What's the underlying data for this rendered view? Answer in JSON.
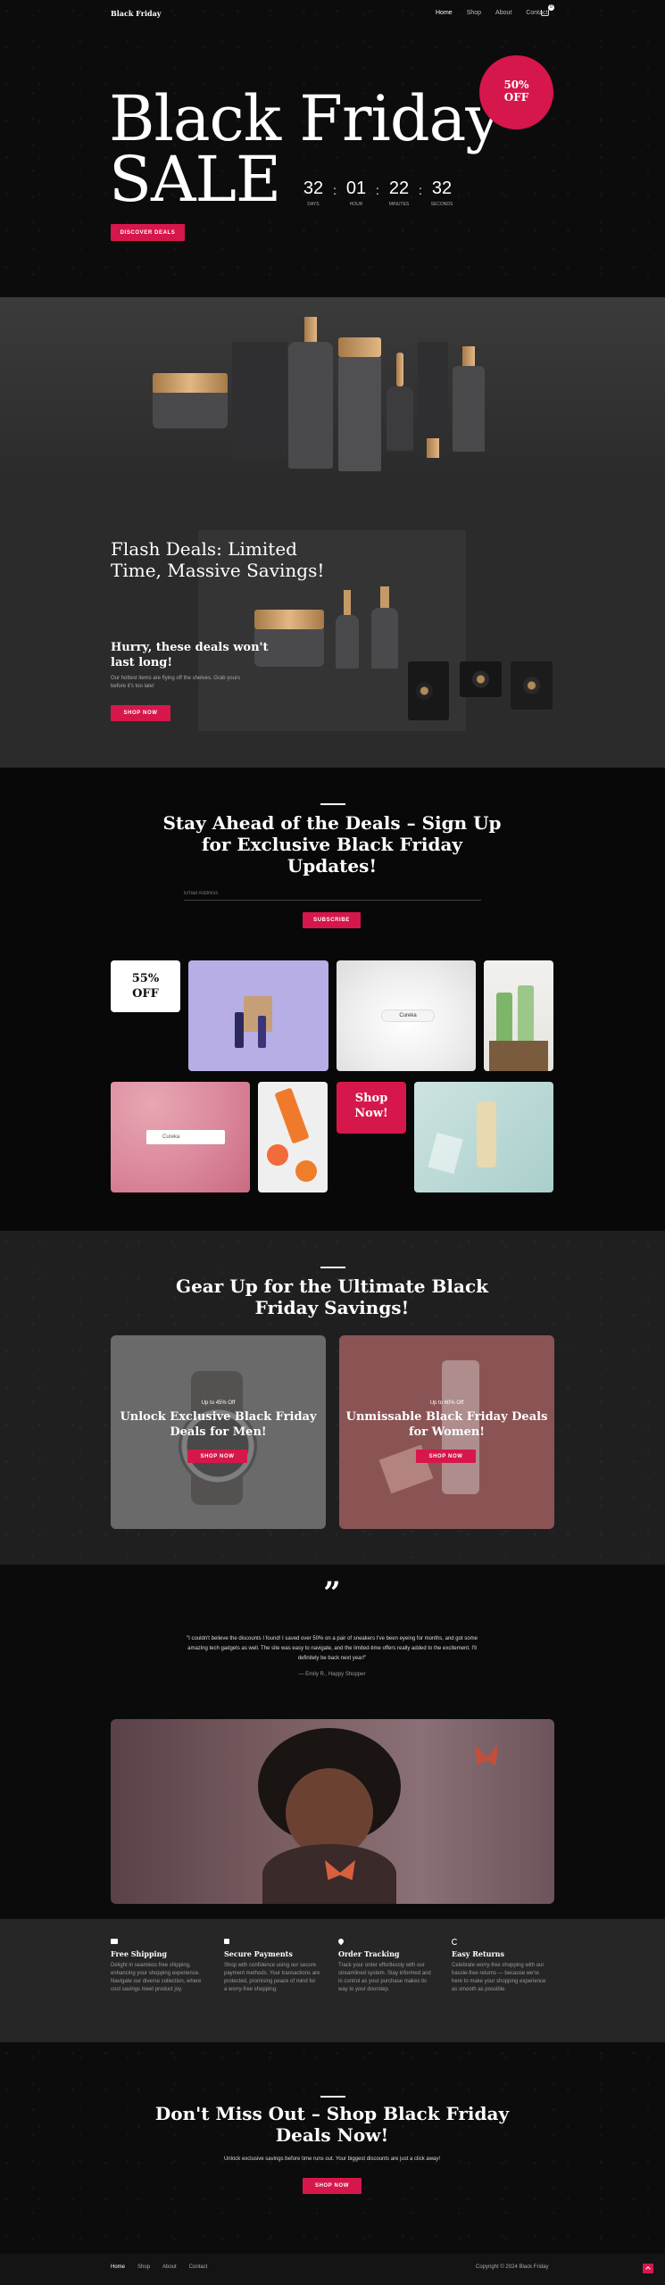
{
  "header": {
    "logo": "Black Friday",
    "nav": [
      "Home",
      "Shop",
      "About",
      "Contact"
    ],
    "cart_count": "0"
  },
  "hero": {
    "line1": "Black Friday",
    "line2": "SALE",
    "badge_pct": "50%",
    "badge_off": "OFF",
    "countdown": [
      {
        "value": "32",
        "label": "DAYS"
      },
      {
        "value": "01",
        "label": "HOUR"
      },
      {
        "value": "22",
        "label": "MINUTES"
      },
      {
        "value": "32",
        "label": "SECONDS"
      }
    ],
    "cta": "DISCOVER DEALS"
  },
  "flash": {
    "title1": "Flash Deals: Limited",
    "title2": "Time, Massive Savings!",
    "sub1": "Hurry, these deals won't",
    "sub2": "last long!",
    "desc1": "Our hottest items are flying off the shelves. Grab yours",
    "desc2": "before it's too late!",
    "cta": "SHOP NOW"
  },
  "signup": {
    "title1": "Stay Ahead of the Deals – Sign Up",
    "title2": "for Exclusive Black Friday",
    "title3": "Updates!",
    "placeholder": "Email Address",
    "cta": "SUBSCRIBE"
  },
  "gallery": {
    "pct": "55%",
    "off": "OFF",
    "shop1": "Shop",
    "shop2": "Now!",
    "product_label": "Cureka"
  },
  "gear": {
    "title1": "Gear Up for the Ultimate Black",
    "title2": "Friday Savings!",
    "cards": [
      {
        "kicker": "Up to 45% Off",
        "title1": "Unlock Exclusive Black Friday",
        "title2": "Deals for Men!",
        "cta": "SHOP NOW"
      },
      {
        "kicker": "Up to 60% Off",
        "title1": "Unmissable Black Friday Deals",
        "title2": "for Women!",
        "cta": "SHOP NOW"
      }
    ]
  },
  "testimonial": {
    "quote_mark": "”",
    "line1": "\"I couldn't believe the discounts I found! I saved over 50% on a pair of sneakers I've been eyeing for months, and got some",
    "line2": "amazing tech gadgets as well. The site was easy to navigate, and the limited-time offers really added to the excitement. I'll",
    "line3": "definitely be back next year!\"",
    "author": "— Emily R., Happy Shopper"
  },
  "features": [
    {
      "icon": "truck-icon",
      "title": "Free Shipping",
      "desc": [
        "Delight in seamless free shipping,",
        "enhancing your shopping experience.",
        "Navigate our diverse collection, where",
        "cost savings meet product joy."
      ]
    },
    {
      "icon": "lock-icon",
      "title": "Secure Payments",
      "desc": [
        "Shop with confidence using our secure",
        "payment methods. Your transactions are",
        "protected, promising peace of mind for",
        "a worry-free shopping."
      ]
    },
    {
      "icon": "pin-icon",
      "title": "Order Tracking",
      "desc": [
        "Track your order effortlessly with our",
        "streamlined system. Stay informed and",
        "in control as your purchase makes its",
        "way to your doorstep."
      ]
    },
    {
      "icon": "return-icon",
      "title": "Easy Returns",
      "desc": [
        "Celebrate worry-free shopping with our",
        "hassle-free returns — because we're",
        "here to make your shopping experience",
        "as smooth as possible."
      ]
    }
  ],
  "final": {
    "title1": "Don't Miss Out – Shop Black Friday",
    "title2": "Deals Now!",
    "desc": "Unlock exclusive savings before time runs out. Your biggest discounts are just a click away!",
    "cta": "SHOP NOW"
  },
  "footer": {
    "nav": [
      "Home",
      "Shop",
      "About",
      "Contact"
    ],
    "copyright": "Copyright © 2024 Black Friday"
  },
  "colors": {
    "accent": "#d6174b",
    "bg": "#0b0b0c",
    "panel": "#262626"
  }
}
